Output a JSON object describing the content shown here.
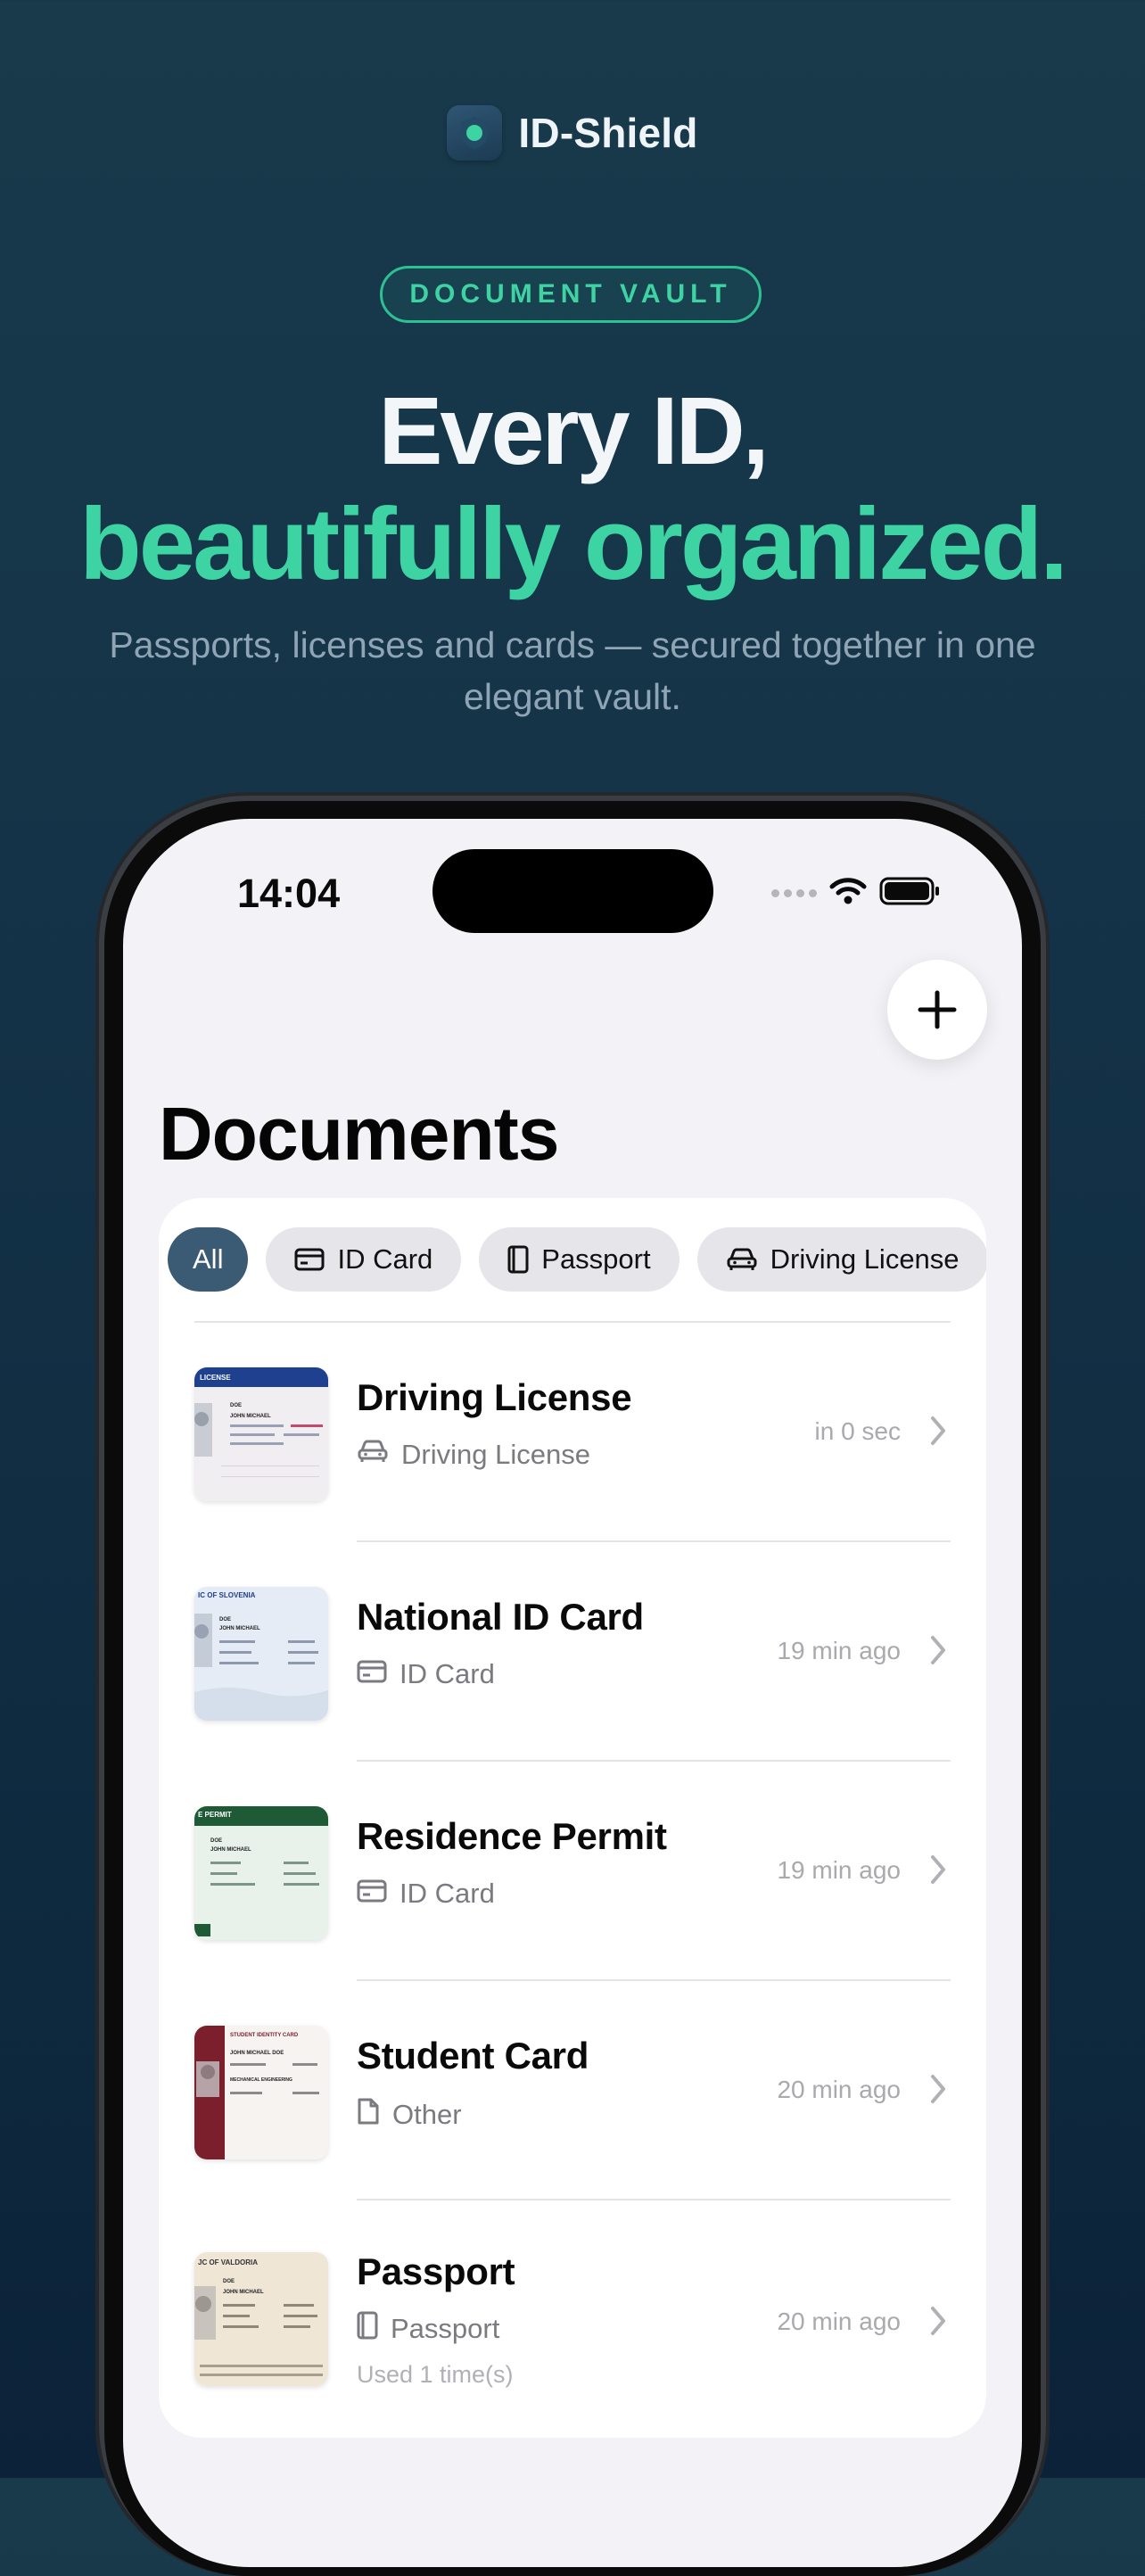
{
  "brand": {
    "name": "ID-Shield"
  },
  "hero": {
    "badge": "DOCUMENT VAULT",
    "headline_line1": "Every ID,",
    "headline_line2": "beautifully organized.",
    "subtitle": "Passports, licenses and cards — secured together in one elegant vault."
  },
  "colors": {
    "accent": "#3dd3a3",
    "chip_active": "#3b5a73",
    "background": "#143247"
  },
  "status_bar": {
    "time": "14:04"
  },
  "screen": {
    "title": "Documents",
    "add_icon": "plus-icon",
    "filters": [
      {
        "label": "All",
        "icon": null,
        "active": true
      },
      {
        "label": "ID Card",
        "icon": "id-card-icon",
        "active": false
      },
      {
        "label": "Passport",
        "icon": "passport-icon",
        "active": false
      },
      {
        "label": "Driving License",
        "icon": "car-icon",
        "active": false
      }
    ],
    "documents": [
      {
        "title": "Driving License",
        "type": "Driving License",
        "type_icon": "car-icon",
        "time": "in 0 sec",
        "used": ""
      },
      {
        "title": "National ID Card",
        "type": "ID Card",
        "type_icon": "id-card-icon",
        "time": "19 min ago",
        "used": ""
      },
      {
        "title": "Residence Permit",
        "type": "ID Card",
        "type_icon": "id-card-icon",
        "time": "19 min ago",
        "used": ""
      },
      {
        "title": "Student Card",
        "type": "Other",
        "type_icon": "document-icon",
        "time": "20 min ago",
        "used": ""
      },
      {
        "title": "Passport",
        "type": "Passport",
        "type_icon": "passport-icon",
        "time": "20 min ago",
        "used": "Used 1 time(s)"
      }
    ],
    "thumbnails": [
      {
        "header": "LICENSE",
        "line1": "DOE",
        "line2": "JOHN MICHAEL",
        "color": "#1f3f8f"
      },
      {
        "header": "IC OF SLOVENIA",
        "line1": "DOE",
        "line2": "JOHN MICHAEL",
        "color": "#1f3f8f"
      },
      {
        "header": "E PERMIT",
        "line1": "DOE",
        "line2": "JOHN MICHAEL",
        "color": "#1e5a35"
      },
      {
        "header": "STUDENT IDENTITY CARD",
        "line1": "JOHN MICHAEL DOE",
        "line2": "MECHANICAL ENGINEERING",
        "color": "#7a1f2b"
      },
      {
        "header": "JC OF VALDORIA",
        "line1": "DOE",
        "line2": "JOHN MICHAEL",
        "color": "#3a3a3a"
      }
    ]
  }
}
